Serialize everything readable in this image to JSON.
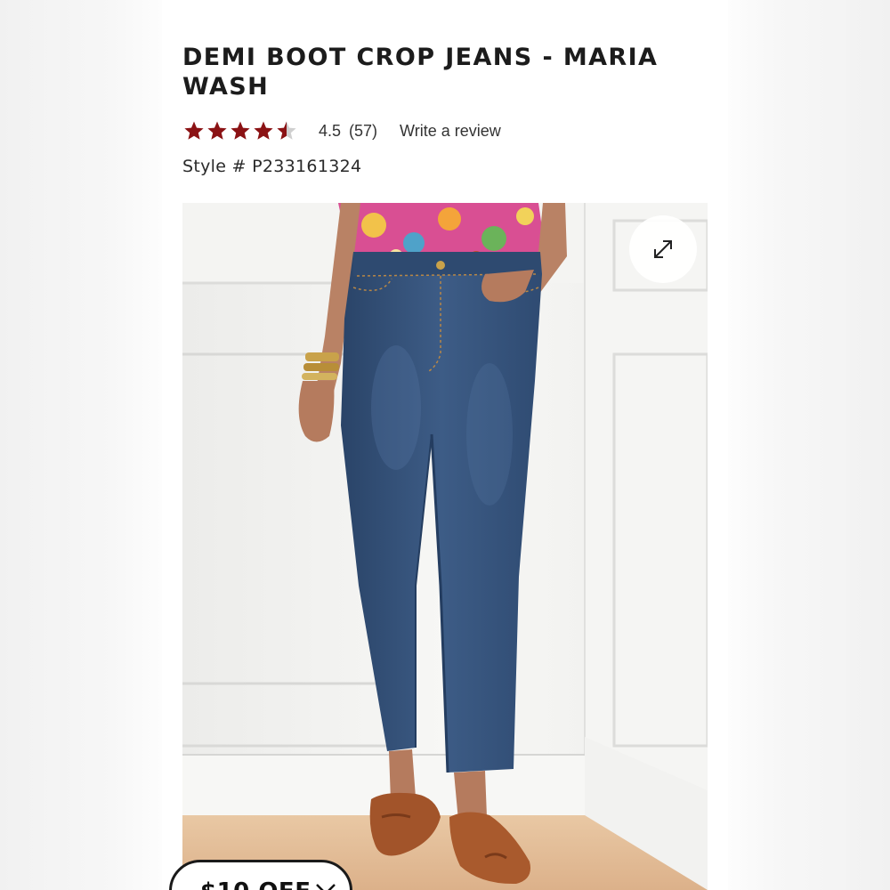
{
  "product": {
    "title": "DEMI BOOT CROP JEANS - MARIA WASH",
    "rating_value": "4.5",
    "rating_fraction": 0.9,
    "review_count": "(57)",
    "write_review_label": "Write a review",
    "style_label": "Style # P233161324"
  },
  "icons": {
    "star": "star-icon",
    "expand": "expand-icon",
    "close": "close-icon"
  },
  "offer": {
    "label": "$10 OFF"
  },
  "colors": {
    "star_fill": "#8b1214",
    "star_empty": "#cfcfcf",
    "denim": "#345178",
    "text": "#1c1c1c"
  }
}
